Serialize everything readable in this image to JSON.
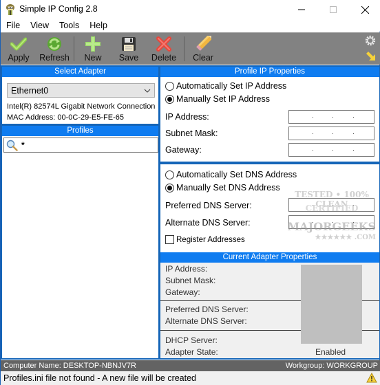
{
  "window": {
    "title": "Simple IP Config 2.8",
    "app_icon": "app-logo-icon",
    "controls": [
      "minimize",
      "maximize",
      "close"
    ]
  },
  "menu": {
    "items": [
      "File",
      "View",
      "Tools",
      "Help"
    ]
  },
  "toolbar": {
    "buttons": [
      {
        "label": "Apply",
        "icon": "checkmark-icon"
      },
      {
        "label": "Refresh",
        "icon": "refresh-icon"
      },
      {
        "label": "New",
        "icon": "plus-icon"
      },
      {
        "label": "Save",
        "icon": "floppy-disk-icon"
      },
      {
        "label": "Delete",
        "icon": "delete-x-icon"
      },
      {
        "label": "Clear",
        "icon": "pencil-eraser-icon"
      }
    ],
    "settings_icon": "gear-icon",
    "collapse_icon": "arrow-down-right-icon"
  },
  "left_panel": {
    "select_adapter_header": "Select Adapter",
    "adapter_selected": "Ethernet0",
    "adapter_description": "Intel(R) 82574L Gigabit Network Connection",
    "mac_address": "MAC Address: 00-0C-29-E5-FE-65",
    "profiles_header": "Profiles",
    "profile_filter_value": "*"
  },
  "profile_ip": {
    "header": "Profile IP Properties",
    "auto_ip_label": "Automatically Set IP Address",
    "manual_ip_label": "Manually Set IP Address",
    "ip_mode": "manual",
    "ip_address_label": "IP Address:",
    "subnet_mask_label": "Subnet Mask:",
    "gateway_label": "Gateway:",
    "ip_address_value": "",
    "subnet_mask_value": "",
    "gateway_value": "",
    "auto_dns_label": "Automatically Set DNS Address",
    "manual_dns_label": "Manually Set DNS Address",
    "dns_mode": "manual",
    "preferred_dns_label": "Preferred DNS Server:",
    "alternate_dns_label": "Alternate DNS Server:",
    "preferred_dns_value": "",
    "alternate_dns_value": "",
    "register_addresses_label": "Register Addresses",
    "register_addresses_checked": false
  },
  "current_adapter": {
    "header": "Current Adapter Properties",
    "ip_address_label": "IP Address:",
    "subnet_mask_label": "Subnet Mask:",
    "gateway_label": "Gateway:",
    "preferred_dns_label": "Preferred DNS Server:",
    "alternate_dns_label": "Alternate DNS Server:",
    "dhcp_server_label": "DHCP Server:",
    "adapter_state_label": "Adapter State:",
    "adapter_state_value": "Enabled"
  },
  "watermark": {
    "line1": "TESTED • 100% CLEAN",
    "line2": "CERTIFIED",
    "line3": "MAJORGEEKS",
    "line4": "★★★★★★  .COM"
  },
  "footer": {
    "computer_name": "Computer Name: DESKTOP-NBNJV7R",
    "workgroup": "Workgroup: WORKGROUP",
    "status_message": "Profiles.ini file not found - A new file will be created",
    "status_icon": "warning-icon"
  },
  "colors": {
    "header_blue": "#0f7cf0",
    "frame_blue": "#1565b8",
    "toolbar_gray": "#828282",
    "computer_bar_gray": "#636363"
  }
}
